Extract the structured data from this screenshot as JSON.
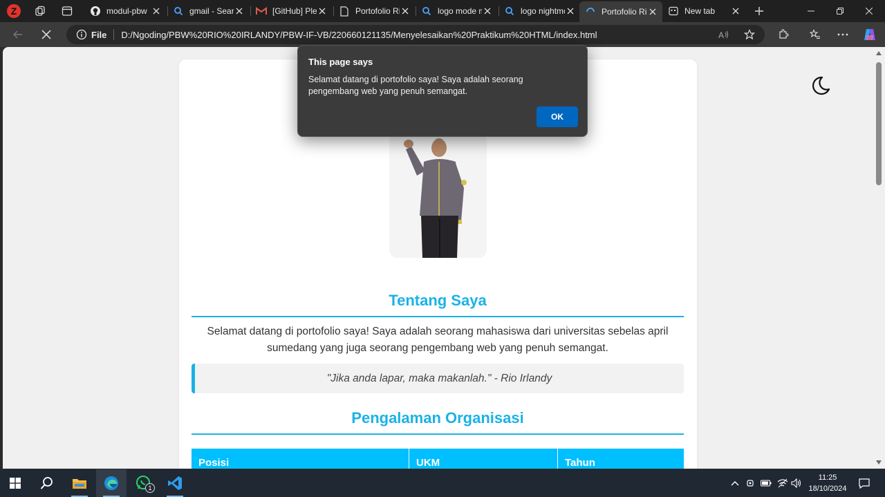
{
  "browser": {
    "tabs": [
      {
        "title": "modul-pbw",
        "icon": "github-icon"
      },
      {
        "title": "gmail - Search",
        "icon": "search-icon"
      },
      {
        "title": "[GitHub] Please",
        "icon": "gmail-icon"
      },
      {
        "title": "Portofolio Rio",
        "icon": "page-icon"
      },
      {
        "title": "logo mode malam",
        "icon": "search-icon"
      },
      {
        "title": "logo nightmode",
        "icon": "search-icon"
      },
      {
        "title": "Portofolio Rio",
        "icon": "loading-icon",
        "active": true
      },
      {
        "title": "New tab",
        "icon": "newtab-icon"
      }
    ],
    "address": {
      "scheme_label": "File",
      "url": "D:/Ngoding/PBW%20RIO%20IRLANDY/PBW-IF-VB/220660121135/Menyelesaikan%20Praktikum%20HTML/index.html"
    }
  },
  "dialog": {
    "title": "This page says",
    "message": "Selamat datang di portofolio saya! Saya adalah seorang pengembang web yang penuh semangat.",
    "ok_label": "OK"
  },
  "page": {
    "about": {
      "title": "Tentang Saya",
      "text": "Selamat datang di portofolio saya! Saya adalah seorang mahasiswa dari universitas sebelas april sumedang yang juga seorang pengembang web yang penuh semangat.",
      "quote": "\"Jika anda lapar, maka makanlah.\" - Rio Irlandy"
    },
    "organization": {
      "title": "Pengalaman Organisasi",
      "columns": [
        "Posisi",
        "UKM",
        "Tahun"
      ]
    }
  },
  "taskbar": {
    "whatsapp_badge": "1",
    "time": "11:25",
    "date": "18/10/2024"
  },
  "colors": {
    "accent": "#1ab2e6",
    "table_header": "#00bfff",
    "dialog_ok": "#0067c0"
  }
}
